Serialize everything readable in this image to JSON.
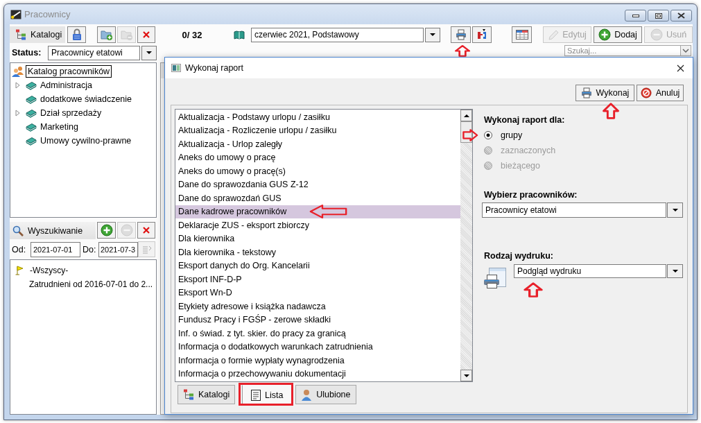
{
  "window": {
    "title": "Pracownicy"
  },
  "toolbar": {
    "left_buttons": [
      {
        "kind": "catalogs",
        "label": "Katalogi",
        "disabled": false
      },
      {
        "kind": "lock",
        "disabled": false
      },
      {
        "kind": "folder_add",
        "disabled": false
      },
      {
        "kind": "folder_remove",
        "disabled": true
      },
      {
        "kind": "delete",
        "disabled": false
      }
    ],
    "counter": "0/ 32",
    "period": {
      "value": "czerwiec 2021, Podstawowy"
    },
    "print_buttons": [
      {
        "kind": "print",
        "annotated": true
      },
      {
        "kind": "export",
        "annotated": false
      }
    ],
    "action_buttons": [
      {
        "kind": "edit",
        "label": "Edytuj",
        "disabled": true
      },
      {
        "kind": "add",
        "label": "Dodaj",
        "disabled": false
      },
      {
        "kind": "remove",
        "label": "Usuń",
        "disabled": true
      }
    ]
  },
  "status": {
    "label": "Status:",
    "value": "Pracownicy etatowi"
  },
  "search": {
    "placeholder": "Szukaj..."
  },
  "tree": {
    "label": "Katalog pracowników",
    "selected": true,
    "children": [
      {
        "label": "Administracja",
        "expandable": true,
        "selected": false
      },
      {
        "label": "dodatkowe świadczenie",
        "expandable": false,
        "selected": false
      },
      {
        "label": "Dział sprzedaży",
        "expandable": true,
        "selected": false
      },
      {
        "label": "Marketing",
        "expandable": false,
        "selected": false
      },
      {
        "label": "Umowy cywilno-prawne",
        "expandable": false,
        "selected": false
      }
    ]
  },
  "search_panel": {
    "title": "Wyszukiwanie",
    "buttons": [
      {
        "kind": "add",
        "disabled": false
      },
      {
        "kind": "remove",
        "disabled": true
      },
      {
        "kind": "delete",
        "disabled": false
      }
    ],
    "from": {
      "label": "Od:",
      "value": "2021-07-01"
    },
    "to": {
      "label": "Do:",
      "value": "2021-07-3"
    },
    "apply_button": {
      "disabled": true
    },
    "filters": [
      {
        "kind": "flag",
        "label": "-Wszyscy-"
      },
      {
        "kind": "plain",
        "label": "Zatrudnieni od 2016-07-01 do 2..."
      }
    ]
  },
  "dialog": {
    "title": "Wykonaj raport",
    "buttons": [
      {
        "kind": "run",
        "label": "Wykonaj",
        "annotated": true
      },
      {
        "kind": "cancel",
        "label": "Anuluj",
        "annotated": false
      }
    ],
    "reports": [
      {
        "label": "Aktualizacja - Podstawy urlopu / zasiłku",
        "selected": false,
        "annotated": false
      },
      {
        "label": "Aktualizacja - Rozliczenie urlopu / zasiłku",
        "selected": false,
        "annotated": false
      },
      {
        "label": "Aktualizacja - Urlop zaległy",
        "selected": false,
        "annotated": false
      },
      {
        "label": "Aneks do umowy o pracę",
        "selected": false,
        "annotated": false
      },
      {
        "label": "Aneks do umowy o pracę(s)",
        "selected": false,
        "annotated": false
      },
      {
        "label": "Dane do sprawozdania GUS Z-12",
        "selected": false,
        "annotated": false
      },
      {
        "label": "Dane do sprawozdań GUS",
        "selected": false,
        "annotated": false
      },
      {
        "label": "Dane kadrowe pracowników",
        "selected": true,
        "annotated": true
      },
      {
        "label": "Deklaracje ZUS - eksport zbiorczy",
        "selected": false,
        "annotated": false
      },
      {
        "label": "Dla kierownika",
        "selected": false,
        "annotated": false
      },
      {
        "label": "Dla kierownika - tekstowy",
        "selected": false,
        "annotated": false
      },
      {
        "label": "Eksport danych do Org. Kancelarii",
        "selected": false,
        "annotated": false
      },
      {
        "label": "Eksport INF-D-P",
        "selected": false,
        "annotated": false
      },
      {
        "label": "Eksport Wn-D",
        "selected": false,
        "annotated": false
      },
      {
        "label": "Etykiety adresowe i książka nadawcza",
        "selected": false,
        "annotated": false
      },
      {
        "label": "Fundusz Pracy i FGŚP - zerowe składki",
        "selected": false,
        "annotated": false
      },
      {
        "label": "Inf. o świad. z tyt. skier. do pracy za granicą",
        "selected": false,
        "annotated": false
      },
      {
        "label": "Informacja o dodatkowych warunkach zatrudnienia",
        "selected": false,
        "annotated": false
      },
      {
        "label": "Informacja o formie wypłaty wynagrodzenia",
        "selected": false,
        "annotated": false
      },
      {
        "label": "Informacja o przechowywaniu dokumentacji",
        "selected": false,
        "annotated": false
      }
    ],
    "scope": {
      "title": "Wykonaj raport dla:",
      "options": [
        {
          "label": "grupy",
          "selected": true,
          "disabled": false,
          "annotated": true
        },
        {
          "label": "zaznaczonych",
          "selected": false,
          "disabled": true,
          "annotated": false
        },
        {
          "label": "bieżącego",
          "selected": false,
          "disabled": true,
          "annotated": false
        }
      ]
    },
    "employees": {
      "label": "Wybierz pracowników:",
      "value": "Pracownicy etatowi"
    },
    "print_type": {
      "label": "Rodzaj wydruku:",
      "value": "Podgląd wydruku",
      "annotated": true
    },
    "tabs": [
      {
        "kind": "tree",
        "label": "Katalogi",
        "selected": false,
        "annotated": false
      },
      {
        "kind": "list",
        "label": "Lista",
        "selected": true,
        "annotated": true
      },
      {
        "kind": "person",
        "label": "Ulubione",
        "selected": false,
        "annotated": false
      }
    ]
  }
}
